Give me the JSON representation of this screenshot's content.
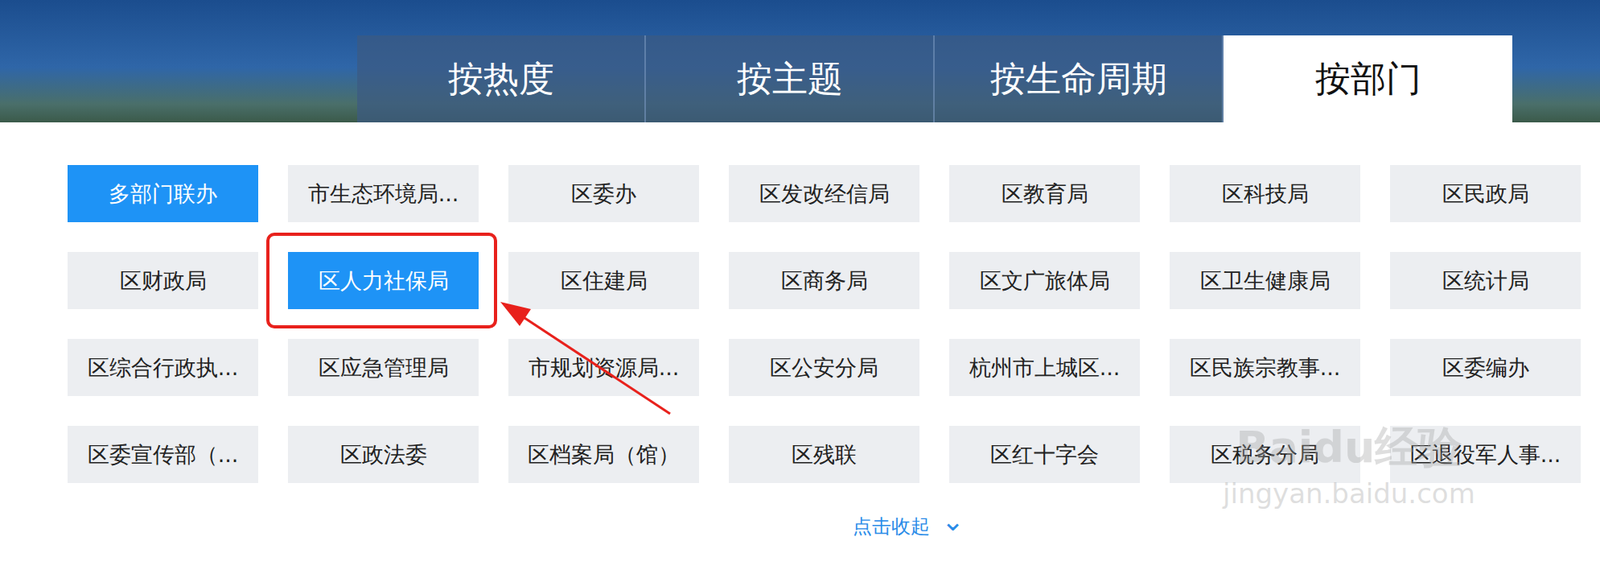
{
  "tabs": [
    {
      "label": "按热度",
      "selected": false
    },
    {
      "label": "按主题",
      "selected": false
    },
    {
      "label": "按生命周期",
      "selected": false
    },
    {
      "label": "按部门",
      "selected": true
    }
  ],
  "departments": [
    {
      "label": "多部门联办",
      "selected": true
    },
    {
      "label": "市生态环境局...",
      "selected": false
    },
    {
      "label": "区委办",
      "selected": false
    },
    {
      "label": "区发改经信局",
      "selected": false
    },
    {
      "label": "区教育局",
      "selected": false
    },
    {
      "label": "区科技局",
      "selected": false
    },
    {
      "label": "区民政局",
      "selected": false
    },
    {
      "label": "区财政局",
      "selected": false
    },
    {
      "label": "区人力社保局",
      "selected": true
    },
    {
      "label": "区住建局",
      "selected": false
    },
    {
      "label": "区商务局",
      "selected": false
    },
    {
      "label": "区文广旅体局",
      "selected": false
    },
    {
      "label": "区卫生健康局",
      "selected": false
    },
    {
      "label": "区统计局",
      "selected": false
    },
    {
      "label": "区综合行政执...",
      "selected": false
    },
    {
      "label": "区应急管理局",
      "selected": false
    },
    {
      "label": "市规划资源局...",
      "selected": false
    },
    {
      "label": "区公安分局",
      "selected": false
    },
    {
      "label": "杭州市上城区...",
      "selected": false
    },
    {
      "label": "区民族宗教事...",
      "selected": false
    },
    {
      "label": "区委编办",
      "selected": false
    },
    {
      "label": "区委宣传部（...",
      "selected": false
    },
    {
      "label": "区政法委",
      "selected": false
    },
    {
      "label": "区档案局（馆）",
      "selected": false
    },
    {
      "label": "区残联",
      "selected": false
    },
    {
      "label": "区红十字会",
      "selected": false
    },
    {
      "label": "区税务分局",
      "selected": false
    },
    {
      "label": "区退役军人事...",
      "selected": false
    }
  ],
  "collapse": {
    "label": "点击收起",
    "icon": "⌄"
  },
  "watermark": {
    "brand": "Baidu经验",
    "url": "jingyan.baidu.com"
  }
}
